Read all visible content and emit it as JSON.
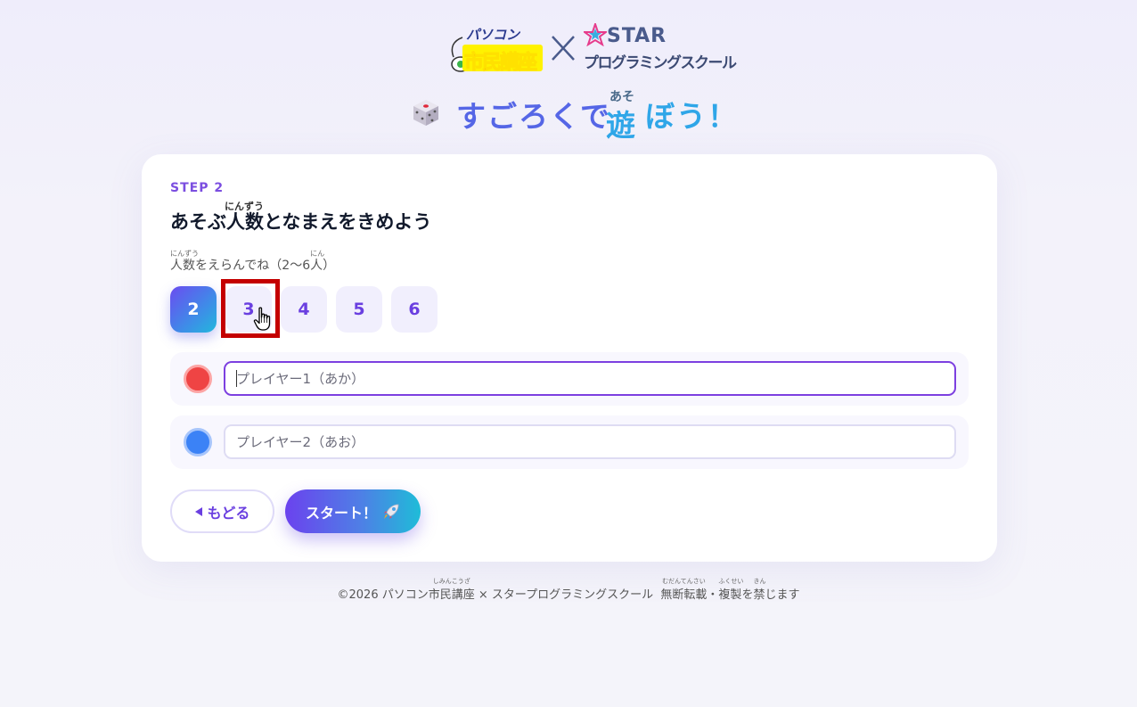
{
  "header": {
    "logo_left": {
      "top": "パソコン",
      "bottom": "市民講座"
    },
    "logo_separator": "×",
    "logo_right": {
      "top": "STAR",
      "bottom": "プログラミングスクール"
    },
    "title_part1": "すごろくで",
    "title_kanji": "遊",
    "title_kanji_ruby": "あそ",
    "title_part2": "ぼう！"
  },
  "card": {
    "step_label": "STEP 2",
    "heading_part1": "あそぶ",
    "heading_kanji": "人数",
    "heading_kanji_ruby": "にんずう",
    "heading_part2": "となまえをきめよう",
    "hint_kanji1": "人数",
    "hint_kanji1_ruby": "にんずう",
    "hint_mid": "をえらんでね（2〜6",
    "hint_kanji2": "人",
    "hint_kanji2_ruby": "にん",
    "hint_end": "）",
    "player_counts": [
      "2",
      "3",
      "4",
      "5",
      "6"
    ],
    "selected_count": "2",
    "players": [
      {
        "placeholder": "プレイヤー1（あか）",
        "value": "",
        "color": "#ef4444",
        "ring": "#fca5a5"
      },
      {
        "placeholder": "プレイヤー2（あお）",
        "value": "",
        "color": "#3b82f6",
        "ring": "#a7c5fb"
      }
    ],
    "back_label": "もどる",
    "start_label": "スタート！"
  },
  "footer": {
    "text1": "©2026 パソコン",
    "kanji1": "市民講座",
    "kanji1_ruby": "しみんこうざ",
    "text2": " × スタープログラミングスクール  ",
    "kanji2": "無断転載",
    "kanji2_ruby": "むだんてんさい",
    "dot": "・",
    "kanji3": "複製",
    "kanji3_ruby": "ふくせい",
    "text3": "を",
    "kanji4": "禁",
    "kanji4_ruby": "きん",
    "text4": "じます"
  },
  "colors": {
    "accent": "#7b4ee0",
    "highlight": "#c40000"
  }
}
